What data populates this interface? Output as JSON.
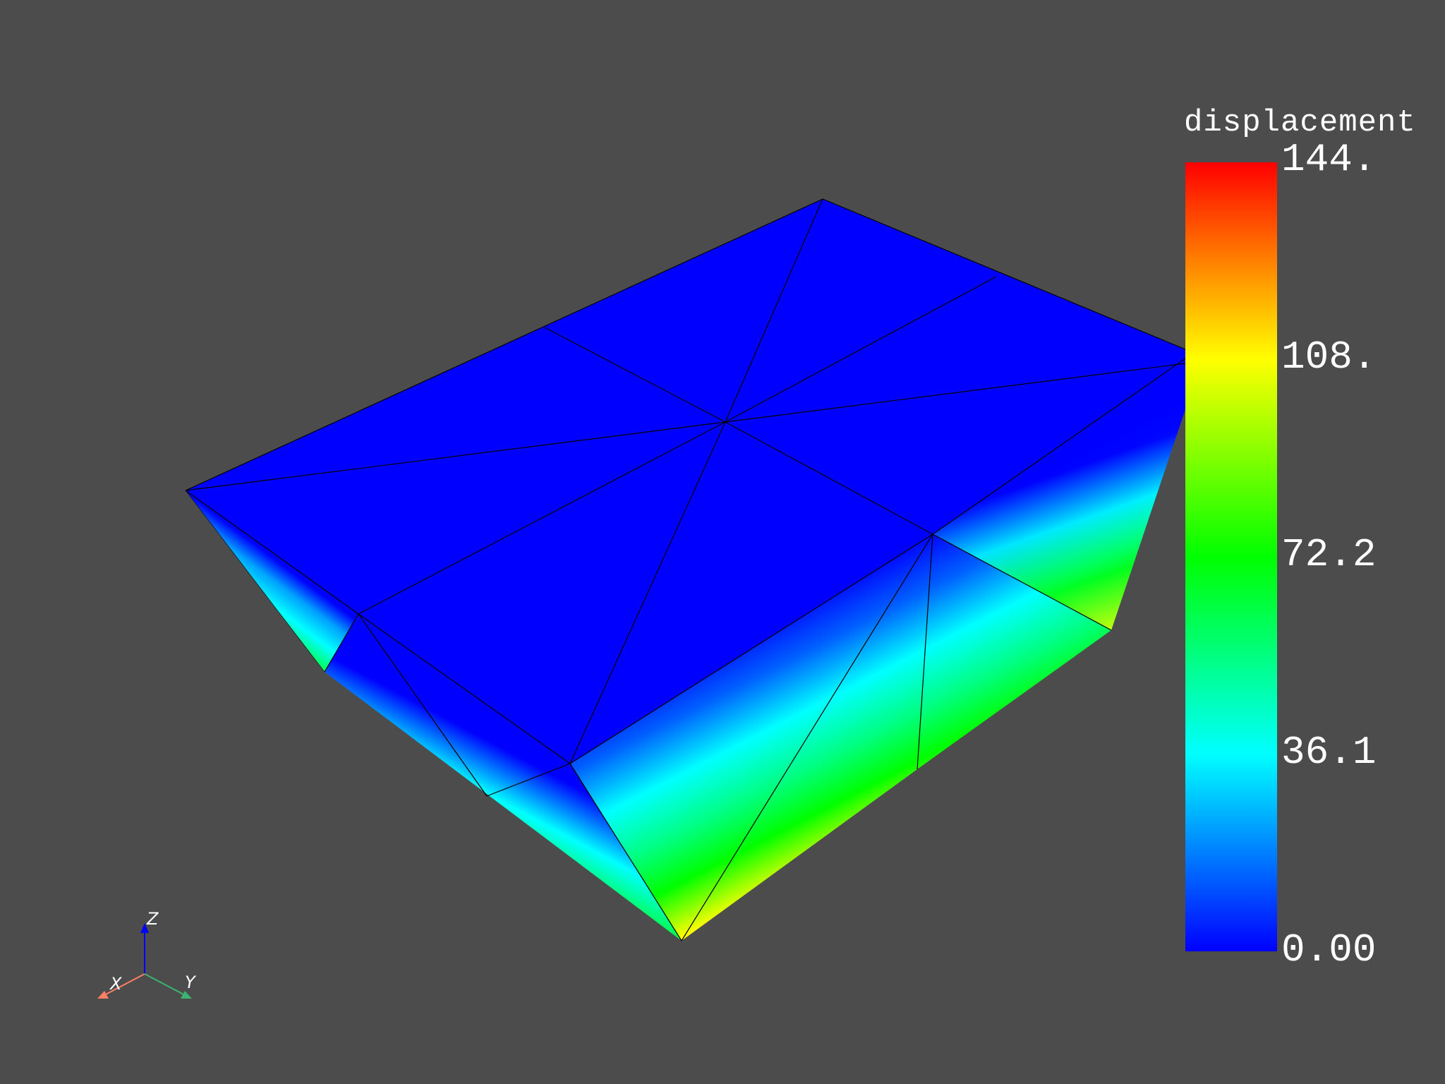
{
  "viewer": {
    "background_color": "#4c4c4c",
    "mesh_edge_color": "#000000"
  },
  "scalar_bar": {
    "title": "displacement",
    "colormap": [
      "#0000ff",
      "#0080ff",
      "#00ffff",
      "#00ff80",
      "#00ff00",
      "#80ff00",
      "#ffff00",
      "#ff8000",
      "#ff0000"
    ],
    "range": [
      0,
      144
    ],
    "ticks": [
      "144.",
      "108.",
      "72.2",
      "36.1",
      "0.00"
    ]
  },
  "orientation_axes": {
    "x_label": "X",
    "y_label": "Y",
    "z_label": "Z",
    "x_color": "#ff7f66",
    "y_color": "#3cb371",
    "z_color": "#0000ff"
  }
}
